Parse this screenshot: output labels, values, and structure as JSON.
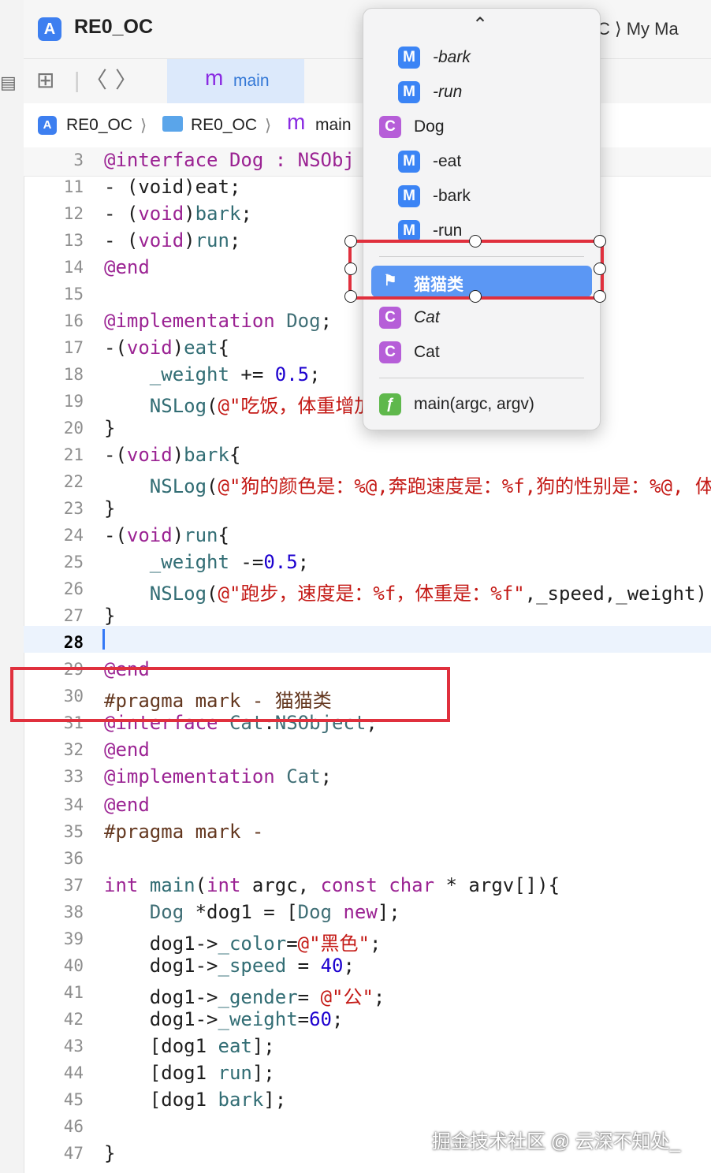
{
  "window": {
    "title": "RE0_OC",
    "trail_text": "C ⟩  My Ma"
  },
  "tabbar": {
    "tab_label": "main"
  },
  "jumpbar": {
    "project": "RE0_OC",
    "folder": "RE0_OC",
    "file": "main",
    "sep": "⟩"
  },
  "sticky_header": {
    "ln": "3",
    "code": "@interface Dog : NSObj"
  },
  "code_lines": [
    {
      "ln": "11",
      "parts": [
        [
          "- (void)eat;",
          ""
        ]
      ]
    },
    {
      "ln": "12",
      "parts": [
        [
          "- (",
          ""
        ],
        [
          "void",
          "kw"
        ],
        [
          ")",
          ""
        ],
        [
          "bark",
          "fn"
        ],
        [
          ";",
          ""
        ]
      ]
    },
    {
      "ln": "13",
      "parts": [
        [
          "- (",
          ""
        ],
        [
          "void",
          "kw"
        ],
        [
          ")",
          ""
        ],
        [
          "run",
          "fn"
        ],
        [
          ";",
          ""
        ]
      ]
    },
    {
      "ln": "14",
      "parts": [
        [
          "@end",
          "kw"
        ]
      ]
    },
    {
      "ln": "15",
      "parts": [
        [
          "",
          ""
        ]
      ]
    },
    {
      "ln": "16",
      "parts": [
        [
          "@implementation",
          "kw"
        ],
        [
          " ",
          ""
        ],
        [
          "Dog",
          "ty"
        ],
        [
          ";",
          ""
        ]
      ]
    },
    {
      "ln": "17",
      "parts": [
        [
          "-(",
          ""
        ],
        [
          "void",
          "kw"
        ],
        [
          ")",
          ""
        ],
        [
          "eat",
          "fn"
        ],
        [
          "{",
          ""
        ]
      ]
    },
    {
      "ln": "18",
      "parts": [
        [
          "    ",
          ""
        ],
        [
          "_weight",
          "fn"
        ],
        [
          " += ",
          ""
        ],
        [
          "0.5",
          "num"
        ],
        [
          ";",
          ""
        ]
      ]
    },
    {
      "ln": "19",
      "parts": [
        [
          "    ",
          ""
        ],
        [
          "NSLog",
          "fn"
        ],
        [
          "(",
          ""
        ],
        [
          "@\"吃饭，体重增加",
          "str"
        ]
      ]
    },
    {
      "ln": "20",
      "parts": [
        [
          "}",
          ""
        ]
      ]
    },
    {
      "ln": "21",
      "parts": [
        [
          "-(",
          ""
        ],
        [
          "void",
          "kw"
        ],
        [
          ")",
          ""
        ],
        [
          "bark",
          "fn"
        ],
        [
          "{",
          ""
        ]
      ]
    },
    {
      "ln": "22",
      "parts": [
        [
          "    ",
          ""
        ],
        [
          "NSLog",
          "fn"
        ],
        [
          "(",
          ""
        ],
        [
          "@\"狗的颜色是：%@,奔跑速度是：%f,狗的性别是：%@, 体",
          "str"
        ]
      ]
    },
    {
      "ln": "23",
      "parts": [
        [
          "}",
          ""
        ]
      ]
    },
    {
      "ln": "24",
      "parts": [
        [
          "-(",
          ""
        ],
        [
          "void",
          "kw"
        ],
        [
          ")",
          ""
        ],
        [
          "run",
          "fn"
        ],
        [
          "{",
          ""
        ]
      ]
    },
    {
      "ln": "25",
      "parts": [
        [
          "    ",
          ""
        ],
        [
          "_weight",
          "fn"
        ],
        [
          " -=",
          ""
        ],
        [
          "0.5",
          "num"
        ],
        [
          ";",
          ""
        ]
      ]
    },
    {
      "ln": "26",
      "parts": [
        [
          "    ",
          ""
        ],
        [
          "NSLog",
          "fn"
        ],
        [
          "(",
          ""
        ],
        [
          "@\"跑步，速度是：%f，体重是：%f\"",
          "str"
        ],
        [
          ",_speed,_weight)",
          ""
        ]
      ]
    },
    {
      "ln": "27",
      "parts": [
        [
          "}",
          ""
        ]
      ]
    },
    {
      "ln": "28",
      "parts": [
        [
          "",
          ""
        ]
      ],
      "current": true
    },
    {
      "ln": "29",
      "parts": [
        [
          "@end",
          "kw"
        ]
      ]
    },
    {
      "ln": "30",
      "parts": [
        [
          "#pragma mark - 猫猫类",
          "pre"
        ]
      ]
    },
    {
      "ln": "31",
      "parts": [
        [
          "@interface",
          "kw"
        ],
        [
          " ",
          ""
        ],
        [
          "Cat",
          "ty"
        ],
        [
          ":",
          ""
        ],
        [
          "NSObject",
          "ty"
        ],
        [
          ";",
          ""
        ]
      ]
    },
    {
      "ln": "32",
      "parts": [
        [
          "@end",
          "kw"
        ]
      ]
    },
    {
      "ln": "33",
      "parts": [
        [
          "@implementation",
          "kw"
        ],
        [
          " ",
          ""
        ],
        [
          "Cat",
          "ty"
        ],
        [
          ";",
          ""
        ]
      ]
    },
    {
      "ln": "34",
      "parts": [
        [
          "@end",
          "kw"
        ]
      ]
    },
    {
      "ln": "35",
      "parts": [
        [
          "#pragma mark -",
          "pre"
        ]
      ]
    },
    {
      "ln": "36",
      "parts": [
        [
          "",
          ""
        ]
      ]
    },
    {
      "ln": "37",
      "parts": [
        [
          "int",
          "kw"
        ],
        [
          " ",
          ""
        ],
        [
          "main",
          "fn"
        ],
        [
          "(",
          ""
        ],
        [
          "int",
          "kw"
        ],
        [
          " argc, ",
          ""
        ],
        [
          "const",
          "kw"
        ],
        [
          " ",
          ""
        ],
        [
          "char",
          "kw"
        ],
        [
          " * argv[]){",
          ""
        ]
      ]
    },
    {
      "ln": "38",
      "parts": [
        [
          "    ",
          ""
        ],
        [
          "Dog",
          "ty"
        ],
        [
          " *dog1 = [",
          ""
        ],
        [
          "Dog",
          "ty"
        ],
        [
          " ",
          ""
        ],
        [
          "new",
          "kw"
        ],
        [
          "];",
          ""
        ]
      ]
    },
    {
      "ln": "39",
      "parts": [
        [
          "    dog1->",
          ""
        ],
        [
          "_color",
          "fn"
        ],
        [
          "=",
          ""
        ],
        [
          "@\"黑色\"",
          "str"
        ],
        [
          ";",
          ""
        ]
      ]
    },
    {
      "ln": "40",
      "parts": [
        [
          "    dog1->",
          ""
        ],
        [
          "_speed",
          "fn"
        ],
        [
          " = ",
          ""
        ],
        [
          "40",
          "num"
        ],
        [
          ";",
          ""
        ]
      ]
    },
    {
      "ln": "41",
      "parts": [
        [
          "    dog1->",
          ""
        ],
        [
          "_gender",
          "fn"
        ],
        [
          "= ",
          ""
        ],
        [
          "@\"公\"",
          "str"
        ],
        [
          ";",
          ""
        ]
      ]
    },
    {
      "ln": "42",
      "parts": [
        [
          "    dog1->",
          ""
        ],
        [
          "_weight",
          "fn"
        ],
        [
          "=",
          ""
        ],
        [
          "60",
          "num"
        ],
        [
          ";",
          ""
        ]
      ]
    },
    {
      "ln": "43",
      "parts": [
        [
          "    [dog1 ",
          ""
        ],
        [
          "eat",
          "fn"
        ],
        [
          "];",
          ""
        ]
      ]
    },
    {
      "ln": "44",
      "parts": [
        [
          "    [dog1 ",
          ""
        ],
        [
          "run",
          "fn"
        ],
        [
          "];",
          ""
        ]
      ]
    },
    {
      "ln": "45",
      "parts": [
        [
          "    [dog1 ",
          ""
        ],
        [
          "bark",
          "fn"
        ],
        [
          "];",
          ""
        ]
      ]
    },
    {
      "ln": "46",
      "parts": [
        [
          "",
          ""
        ]
      ]
    },
    {
      "ln": "47",
      "parts": [
        [
          "}",
          ""
        ]
      ]
    }
  ],
  "popup": {
    "chevron": "⌃",
    "items": [
      {
        "badge": "M",
        "label": "-bark",
        "italic": true,
        "indent": true
      },
      {
        "badge": "M",
        "label": "-run",
        "italic": true,
        "indent": true
      },
      {
        "badge": "C",
        "label": "Dog",
        "italic": false,
        "indent": false
      },
      {
        "badge": "M",
        "label": "-eat",
        "italic": false,
        "indent": true
      },
      {
        "badge": "M",
        "label": "-bark",
        "italic": false,
        "indent": true
      },
      {
        "badge": "M",
        "label": "-run",
        "italic": false,
        "indent": true
      },
      {
        "badge": "flag",
        "label": "猫猫类",
        "italic": false,
        "indent": false,
        "selected": true
      },
      {
        "badge": "C",
        "label": "Cat",
        "italic": true,
        "indent": false
      },
      {
        "badge": "C",
        "label": "Cat",
        "italic": false,
        "indent": false
      },
      {
        "badge": "f",
        "label": "main(argc, argv)",
        "italic": false,
        "indent": false
      }
    ]
  },
  "watermark": "掘金技术社区 @ 云深不知处_",
  "colors": {
    "keyword": "#9b2393",
    "string": "#c41a16",
    "number": "#1c00cf",
    "highlight": "#e0303d",
    "selection": "#5b97f4"
  }
}
